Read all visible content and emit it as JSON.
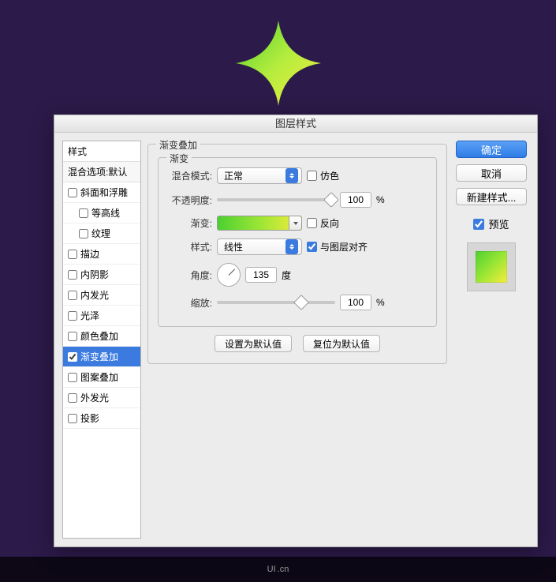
{
  "dialog": {
    "title": "图层样式",
    "styles_header": "样式",
    "blending_header": "混合选项:默认",
    "style_items": [
      {
        "label": "斜面和浮雕",
        "checked": false,
        "indent": false
      },
      {
        "label": "等高线",
        "checked": false,
        "indent": true
      },
      {
        "label": "纹理",
        "checked": false,
        "indent": true
      },
      {
        "label": "描边",
        "checked": false,
        "indent": false
      },
      {
        "label": "内阴影",
        "checked": false,
        "indent": false
      },
      {
        "label": "内发光",
        "checked": false,
        "indent": false
      },
      {
        "label": "光泽",
        "checked": false,
        "indent": false
      },
      {
        "label": "颜色叠加",
        "checked": false,
        "indent": false
      },
      {
        "label": "渐变叠加",
        "checked": true,
        "indent": false,
        "selected": true
      },
      {
        "label": "图案叠加",
        "checked": false,
        "indent": false
      },
      {
        "label": "外发光",
        "checked": false,
        "indent": false
      },
      {
        "label": "投影",
        "checked": false,
        "indent": false
      }
    ]
  },
  "panel": {
    "legend": "渐变叠加",
    "inner_legend": "渐变",
    "blend_mode_label": "混合模式:",
    "blend_mode_value": "正常",
    "dither_label": "仿色",
    "dither_checked": false,
    "opacity_label": "不透明度:",
    "opacity_value": "100",
    "opacity_unit": "%",
    "gradient_label": "渐变:",
    "reverse_label": "反向",
    "reverse_checked": false,
    "style_label": "样式:",
    "style_value": "线性",
    "align_label": "与图层对齐",
    "align_checked": true,
    "angle_label": "角度:",
    "angle_value": "135",
    "angle_unit": "度",
    "scale_label": "缩放:",
    "scale_value": "100",
    "scale_unit": "%",
    "set_default": "设置为默认值",
    "reset_default": "复位为默认值"
  },
  "buttons": {
    "ok": "确定",
    "cancel": "取消",
    "new_style": "新建样式...",
    "preview": "预览",
    "preview_checked": true
  },
  "footer": {
    "brand": "UI",
    "suffix": ".cn"
  }
}
